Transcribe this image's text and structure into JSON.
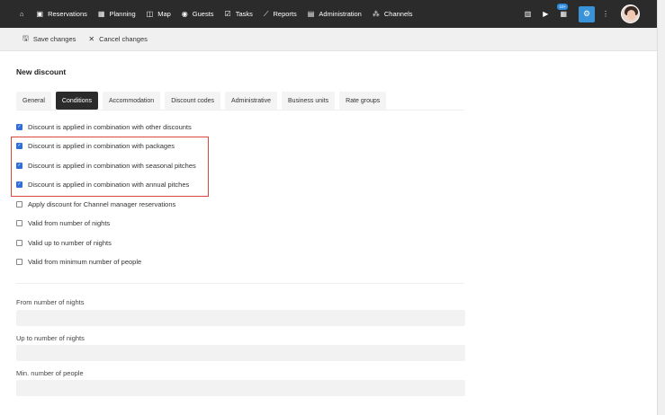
{
  "nav": {
    "items": [
      {
        "label": "Reservations",
        "icon": "reservations-icon",
        "glyph": "▣"
      },
      {
        "label": "Planning",
        "icon": "calendar-icon",
        "glyph": "▦"
      },
      {
        "label": "Map",
        "icon": "map-icon",
        "glyph": "◫"
      },
      {
        "label": "Guests",
        "icon": "guests-icon",
        "glyph": "👥"
      },
      {
        "label": "Tasks",
        "icon": "tasks-icon",
        "glyph": "☑"
      },
      {
        "label": "Reports",
        "icon": "reports-icon",
        "glyph": "⟋"
      },
      {
        "label": "Administration",
        "icon": "administration-icon",
        "glyph": "▤"
      },
      {
        "label": "Channels",
        "icon": "channels-icon",
        "glyph": "⁂"
      }
    ],
    "badge": "10+"
  },
  "toolbar": {
    "save_label": "Save changes",
    "cancel_label": "Cancel changes"
  },
  "page": {
    "title": "New discount"
  },
  "tabs": [
    {
      "label": "General",
      "active": false
    },
    {
      "label": "Conditions",
      "active": true
    },
    {
      "label": "Accommodation",
      "active": false
    },
    {
      "label": "Discount codes",
      "active": false
    },
    {
      "label": "Administrative",
      "active": false
    },
    {
      "label": "Business units",
      "active": false
    },
    {
      "label": "Rate groups",
      "active": false
    }
  ],
  "checkboxes": [
    {
      "label": "Discount is applied in combination with other discounts",
      "checked": true
    },
    {
      "label": "Discount is applied in combination with packages",
      "checked": true
    },
    {
      "label": "Discount is applied in combination with seasonal pitches",
      "checked": true
    },
    {
      "label": "Discount is applied in combination with annual pitches",
      "checked": true
    },
    {
      "label": "Apply discount for Channel manager reservations",
      "checked": false
    },
    {
      "label": "Valid from number of nights",
      "checked": false
    },
    {
      "label": "Valid up to number of nights",
      "checked": false
    },
    {
      "label": "Valid from minimum number of people",
      "checked": false
    }
  ],
  "fields": [
    {
      "label": "From number of nights",
      "value": ""
    },
    {
      "label": "Up to number of nights",
      "value": ""
    },
    {
      "label": "Min. number of people",
      "value": ""
    }
  ],
  "colors": {
    "nav_bg": "#2b2b2b",
    "accent": "#3a93d8",
    "highlight": "#d9473f",
    "checkbox": "#2f6fd6"
  }
}
